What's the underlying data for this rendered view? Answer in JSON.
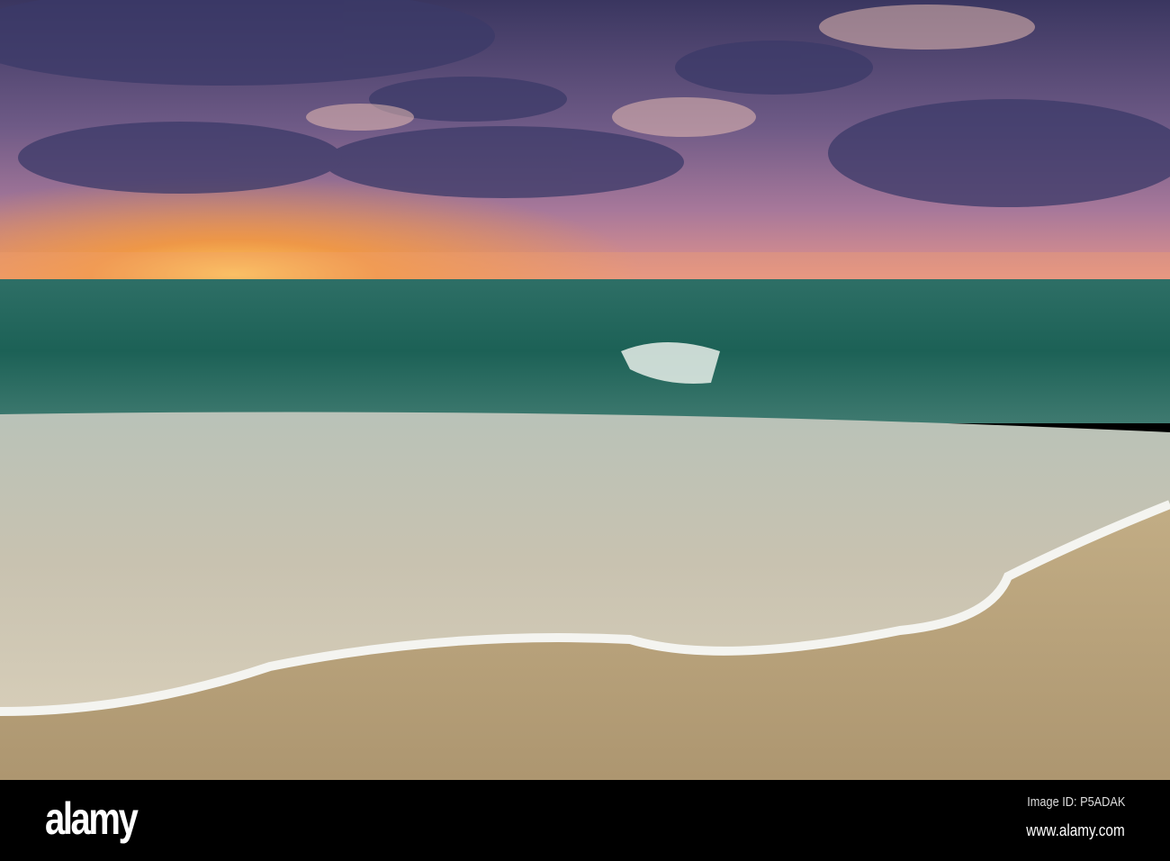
{
  "watermark": {
    "logo": "alamy",
    "image_id": "Image ID: P5ADAK",
    "site": "www.alamy.com"
  },
  "colors": {
    "sky_dark": "#3c3a66",
    "sunset": "#f7a83a",
    "sea": "#1f6a5c",
    "foam": "#e8e6df",
    "sand": "#b49e78"
  }
}
